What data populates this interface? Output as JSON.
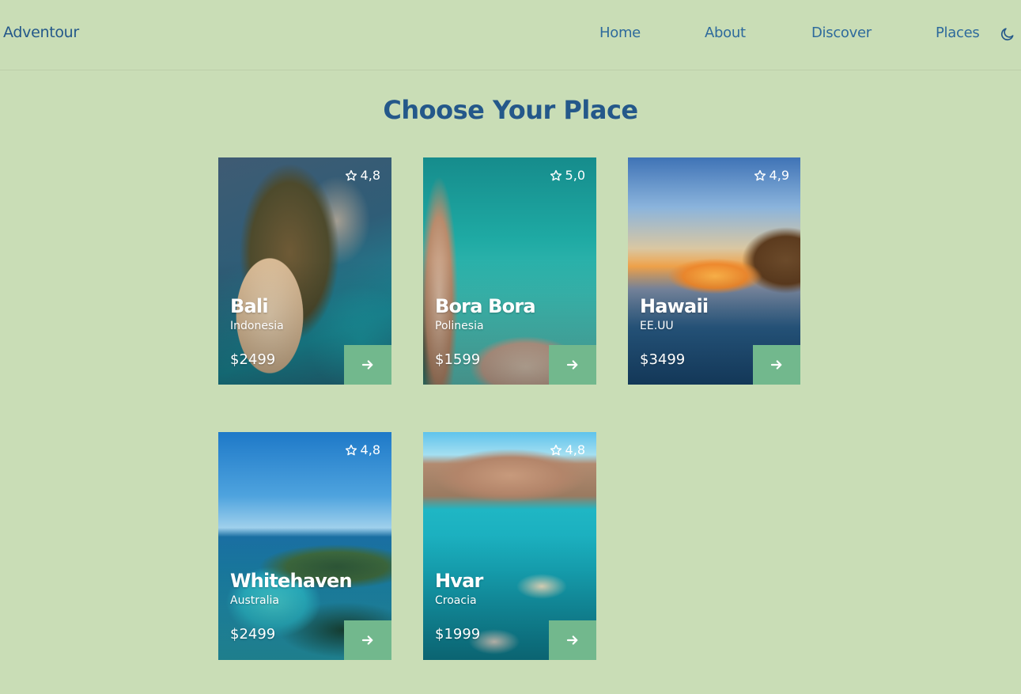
{
  "header": {
    "logo": "Adventour",
    "nav": [
      "Home",
      "About",
      "Discover",
      "Places"
    ],
    "theme_icon": "moon-icon"
  },
  "main": {
    "title": "Choose Your Place"
  },
  "places": [
    {
      "name": "Bali",
      "country": "Indonesia",
      "price": "$2499",
      "rating": "4,8"
    },
    {
      "name": "Bora Bora",
      "country": "Polinesia",
      "price": "$1599",
      "rating": "5,0"
    },
    {
      "name": "Hawaii",
      "country": "EE.UU",
      "price": "$3499",
      "rating": "4,9"
    },
    {
      "name": "Whitehaven",
      "country": "Australia",
      "price": "$2499",
      "rating": "4,8"
    },
    {
      "name": "Hvar",
      "country": "Croacia",
      "price": "$1999",
      "rating": "4,8"
    }
  ],
  "colors": {
    "background": "#c9ddb6",
    "text_primary": "#24588a",
    "button": "#72b88d"
  },
  "icons": {
    "rating": "star-icon",
    "go": "arrow-right-icon"
  }
}
